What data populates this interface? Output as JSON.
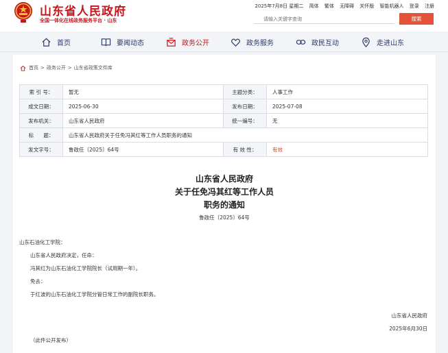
{
  "header": {
    "site_title": "山东省人民政府",
    "site_subtitle": "全国一体化在线政务服务平台 · 山东",
    "date_weekday": "2025年7月8日 星期二",
    "links": [
      "简体",
      "繁体",
      "无障碍",
      "关怀版",
      "智能机器人",
      "登录",
      "注册"
    ],
    "search_placeholder": "请输入关键字查询",
    "search_button": "搜索",
    "brand_color": "#c4161c"
  },
  "nav": {
    "items": [
      {
        "label": "首页",
        "icon": "home-icon"
      },
      {
        "label": "要闻动态",
        "icon": "book-icon"
      },
      {
        "label": "政务公开",
        "icon": "mailbox-icon",
        "active": true
      },
      {
        "label": "政务服务",
        "icon": "heart-hands-icon"
      },
      {
        "label": "政民互动",
        "icon": "link-icon"
      },
      {
        "label": "走进山东",
        "icon": "map-pin-icon"
      }
    ]
  },
  "breadcrumb": {
    "items": [
      "首页",
      "政务公开",
      "山东省政策文件库"
    ],
    "separator": ">"
  },
  "meta": {
    "index_key": "索 引 号：",
    "index_val": "暂无",
    "topic_key": "主题分类：",
    "topic_val": "人事工作",
    "made_key": "成文日期：",
    "made_val": "2025-06-30",
    "pub_key": "发布日期：",
    "pub_val": "2025-07-08",
    "issuer_key": "发布机关：",
    "issuer_val": "山东省人民政府",
    "serial_key": "统一编号：",
    "serial_val": "无",
    "title_key": "标      题：",
    "title_val": "山东省人民政府关于任免冯其红等工作人员职务的通知",
    "docno_key": "发文字号：",
    "docno_val": "鲁政任〔2025〕64号",
    "valid_key": "有 效 性：",
    "valid_val": "有效"
  },
  "document": {
    "title_line1": "山东省人民政府",
    "title_line2": "关于任免冯其红等工作人员",
    "title_line3": "职务的通知",
    "doc_number": "鲁政任〔2025〕64号",
    "recipient": "山东石油化工学院：",
    "para1": "山东省人民政府决定，任命：",
    "para2": "冯其红为山东石油化工学院院长（试用期一年）。",
    "para3": "免去：",
    "para4": "于红波的山东石油化工学院分管日常工作的副院长职务。",
    "signer": "山东省人民政府",
    "sign_date": "2025年6月30日",
    "note": "（此件公开发布）"
  }
}
